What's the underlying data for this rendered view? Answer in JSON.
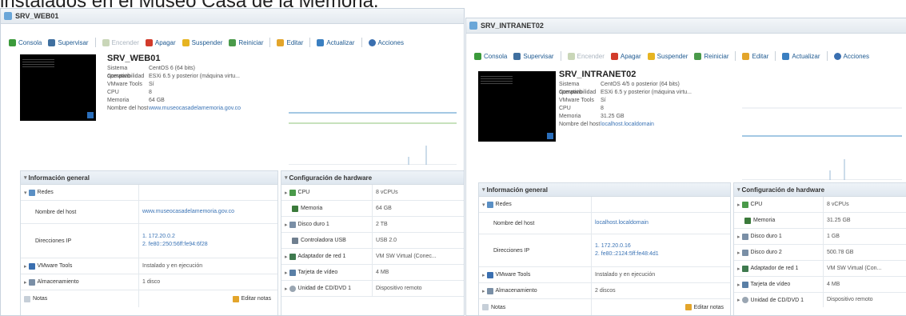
{
  "caption": "instalados en el Museo Casa de la Memoria.",
  "colors": {
    "link": "#3a73b5",
    "toolbar_text": "#1f5a91",
    "console_bg": "#000000",
    "panel_header": "#dfe7ef"
  },
  "toolbar_icons": [
    "console-icon",
    "monitor-icon",
    "power-on-icon",
    "power-off-icon",
    "suspend-icon",
    "restart-icon",
    "edit-icon",
    "refresh-icon",
    "actions-icon"
  ],
  "left": {
    "title": "SRV_WEB01",
    "toolbar": [
      "Consola",
      "Supervisar",
      "Encender",
      "Apagar",
      "Suspender",
      "Reiniciar",
      "Editar",
      "Actualizar",
      "Acciones"
    ],
    "name": "SRV_WEB01",
    "summary": [
      {
        "k": "Sistema operativo",
        "v": "CentOS 6 (64 bits)"
      },
      {
        "k": "Compatibilidad",
        "v": "ESXi 6.5 y posterior (máquina virtu..."
      },
      {
        "k": "VMware Tools",
        "v": "Sí"
      },
      {
        "k": "CPU",
        "v": "8"
      },
      {
        "k": "Memoria",
        "v": "64 GB"
      },
      {
        "k": "Nombre del host",
        "v": "www.museocasadelamemoria.gov.co"
      }
    ],
    "info": {
      "header": "Información general",
      "rows": [
        {
          "k": "Redes",
          "v": ""
        },
        {
          "k": "Nombre del host",
          "v": "www.museocasadelamemoria.gov.co"
        },
        {
          "k": "Direcciones IP",
          "v": "1. 172.20.0.2",
          "v2": "2. fe80::250:56ff:fe94:6f28"
        },
        {
          "k": "VMware Tools",
          "v": "Instalado y en ejecución"
        },
        {
          "k": "Almacenamiento",
          "v": "1 disco"
        },
        {
          "k": "Notas",
          "v": ""
        }
      ],
      "edit_notes": "Editar notas"
    },
    "hw": {
      "header": "Configuración de hardware",
      "rows": [
        {
          "k": "CPU",
          "v": "8 vCPUs"
        },
        {
          "k": "Memoria",
          "v": "64 GB"
        },
        {
          "k": "Disco duro 1",
          "v": "2 TB"
        },
        {
          "k": "Controladora USB",
          "v": "USB 2.0"
        },
        {
          "k": "Adaptador de red 1",
          "v": "VM SW Virtual (Conec..."
        },
        {
          "k": "Tarjeta de vídeo",
          "v": "4 MB"
        },
        {
          "k": "Unidad de CD/DVD 1",
          "v": "Dispositivo remoto"
        }
      ]
    }
  },
  "right": {
    "title": "SRV_INTRANET02",
    "toolbar": [
      "Consola",
      "Supervisar",
      "Encender",
      "Apagar",
      "Suspender",
      "Reiniciar",
      "Editar",
      "Actualizar",
      "Acciones"
    ],
    "name": "SRV_INTRANET02",
    "summary": [
      {
        "k": "Sistema operativo",
        "v": "CentOS 4/5 o posterior (64 bits)"
      },
      {
        "k": "Compatibilidad",
        "v": "ESXi 6.5 y posterior (máquina virtu..."
      },
      {
        "k": "VMware Tools",
        "v": "Sí"
      },
      {
        "k": "CPU",
        "v": "8"
      },
      {
        "k": "Memoria",
        "v": "31.25 GB"
      },
      {
        "k": "Nombre del host",
        "v": "localhost.localdomain"
      }
    ],
    "info": {
      "header": "Información general",
      "rows": [
        {
          "k": "Redes",
          "v": ""
        },
        {
          "k": "Nombre del host",
          "v": "localhost.localdomain"
        },
        {
          "k": "Direcciones IP",
          "v": "1. 172.20.0.16",
          "v2": "2. fe80::2124:5ff:fe48:4d1"
        },
        {
          "k": "VMware Tools",
          "v": "Instalado y en ejecución"
        },
        {
          "k": "Almacenamiento",
          "v": "2 discos"
        },
        {
          "k": "Notas",
          "v": ""
        }
      ],
      "edit_notes": "Editar notas"
    },
    "hw": {
      "header": "Configuración de hardware",
      "rows": [
        {
          "k": "CPU",
          "v": "8 vCPUs"
        },
        {
          "k": "Memoria",
          "v": "31.25 GB"
        },
        {
          "k": "Disco duro 1",
          "v": "1 GB"
        },
        {
          "k": "Disco duro 2",
          "v": "500.78 GB"
        },
        {
          "k": "Adaptador de red 1",
          "v": "VM SW Virtual (Con..."
        },
        {
          "k": "Tarjeta de vídeo",
          "v": "4 MB"
        },
        {
          "k": "Unidad de CD/DVD 1",
          "v": "Dispositivo remoto"
        }
      ]
    }
  }
}
